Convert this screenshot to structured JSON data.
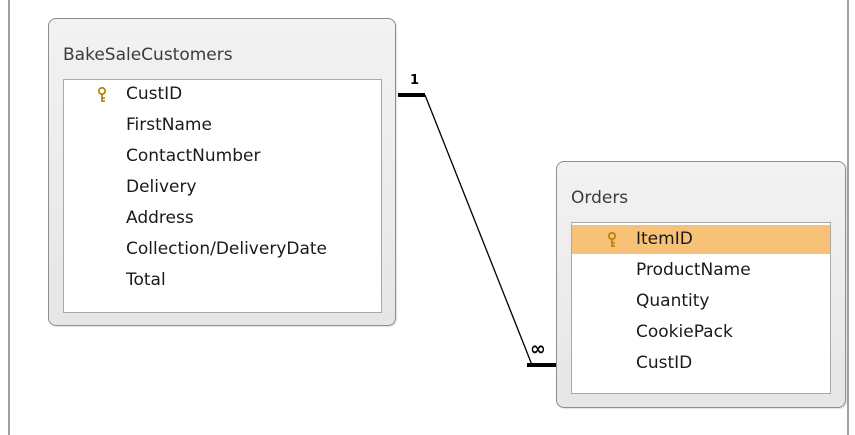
{
  "diagram": {
    "tables": [
      {
        "id": "bake-sale-customers",
        "title": "BakeSaleCustomers",
        "fields": [
          {
            "name": "CustID",
            "primary_key": true
          },
          {
            "name": "FirstName"
          },
          {
            "name": "ContactNumber"
          },
          {
            "name": "Delivery"
          },
          {
            "name": "Address"
          },
          {
            "name": "Collection/DeliveryDate"
          },
          {
            "name": "Total"
          }
        ]
      },
      {
        "id": "orders",
        "title": "Orders",
        "fields": [
          {
            "name": "ItemID",
            "primary_key": true,
            "selected": true
          },
          {
            "name": "ProductName"
          },
          {
            "name": "Quantity"
          },
          {
            "name": "CookiePack"
          },
          {
            "name": "CustID"
          }
        ]
      }
    ],
    "relationship": {
      "from_table": "BakeSaleCustomers",
      "from_field": "CustID",
      "to_table": "Orders",
      "to_field": "CustID",
      "one_label": "1",
      "many_label": "∞"
    }
  },
  "colors": {
    "selected_row": "#f7c277",
    "key_icon": "#b8860b"
  }
}
